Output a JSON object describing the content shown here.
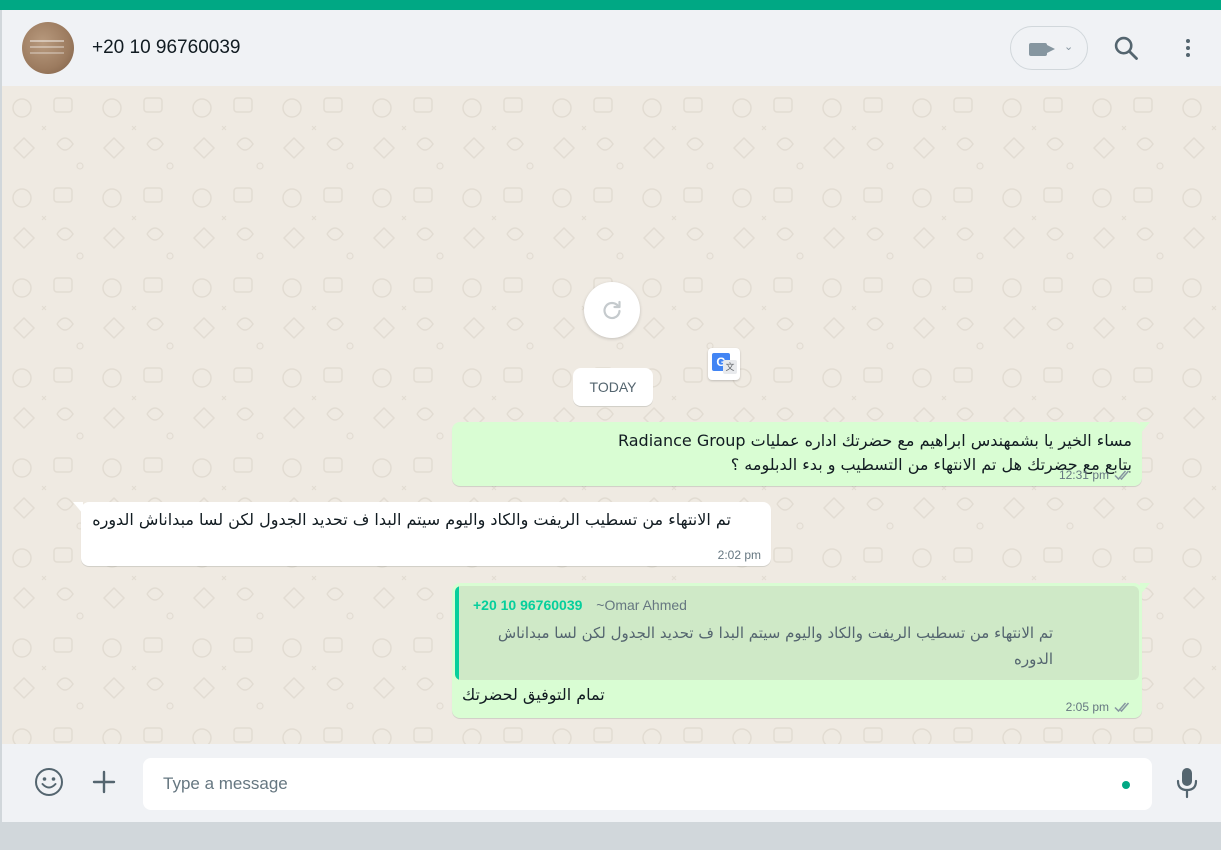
{
  "header": {
    "contact_name": "+20 10 96760039",
    "video_icon": "video-camera-icon",
    "search_icon": "search-icon",
    "menu_icon": "three-dots-menu-icon"
  },
  "chat": {
    "date_label": "TODAY",
    "refresh_icon": "refresh-icon",
    "translate_icon": "google-translate-icon",
    "messages": [
      {
        "direction": "outgoing",
        "text": "مساء الخير يا بشمهندس ابراهيم مع  حضرتك اداره عمليات Radiance Group\nبتابع مع حضرتك هل تم الانتهاء من التسطيب و بدء الدبلومه ؟",
        "time": "12:31 pm",
        "status": "read"
      },
      {
        "direction": "incoming",
        "text": "تم الانتهاء من تسطيب الريفت والكاد واليوم سيتم البدا ف تحديد الجدول لكن لسا مبداناش الدوره",
        "time": "2:02 pm"
      },
      {
        "direction": "outgoing",
        "quote": {
          "sender_number": "+20 10 96760039",
          "sender_alias": "~Omar Ahmed",
          "text": "تم الانتهاء من تسطيب الريفت والكاد واليوم سيتم البدا ف تحديد الجدول لكن لسا مبداناش الدوره"
        },
        "text": "تمام التوفيق لحضرتك",
        "time": "2:05 pm",
        "status": "read"
      }
    ]
  },
  "composer": {
    "placeholder": "Type a message",
    "emoji_icon": "emoji-icon",
    "attach_icon": "plus-icon",
    "mic_icon": "microphone-icon"
  },
  "colors": {
    "accent": "#00a884",
    "outgoing_bubble": "#d9fdd3",
    "incoming_bubble": "#ffffff",
    "chat_background": "#efeae2",
    "quote_accent": "#06cf9c"
  }
}
